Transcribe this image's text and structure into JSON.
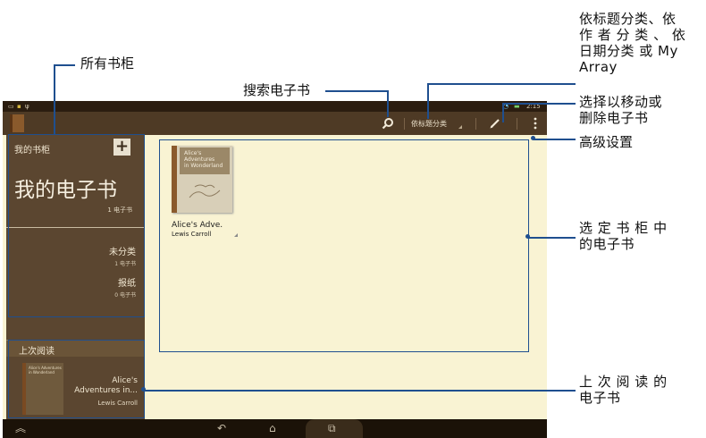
{
  "status_bar": {
    "time": "2:15"
  },
  "action_bar": {
    "sort_label": "依标题分类"
  },
  "sidebar": {
    "header_title": "我的书柜",
    "add_symbol": "+",
    "shelf_title": "我的电子书",
    "shelf_count": "1 电子书",
    "categories": [
      {
        "name": "未分类",
        "count": "1 电子书"
      },
      {
        "name": "报纸",
        "count": "0 电子书"
      }
    ],
    "recent_title": "上次阅读",
    "recent_book": {
      "cover_text": "Alice's Adventures in Wonderland",
      "title_line1": "Alice's",
      "title_line2": "Adventures in...",
      "author": "Lewis Carroll"
    }
  },
  "bookshelf": {
    "books": [
      {
        "cover_line1": "Alice's",
        "cover_line2": "Adventures",
        "cover_line3": "in Wonderland",
        "title": "Alice's Adve.",
        "author": "Lewis Carroll"
      }
    ]
  },
  "callouts": {
    "all_shelves": "所有书柜",
    "search": "搜索电子书",
    "sort_line1": "依标题分类、依",
    "sort_line2": "作 者 分 类 、 依",
    "sort_line3": "日期分类 或 My",
    "sort_line4": "Array",
    "select_line1": "选择以移动或",
    "select_line2": "删除电子书",
    "advanced": "高级设置",
    "shelf_books_line1": "选 定 书 柜 中",
    "shelf_books_line2": "的电子书",
    "last_read_line1": "上 次 阅 读 的",
    "last_read_line2": "电子书"
  },
  "colors": {
    "callout": "#1f4f8f",
    "action_bar": "#4e3a25",
    "sidebar": "#5b4630",
    "content_bg": "#f9f3d3"
  }
}
